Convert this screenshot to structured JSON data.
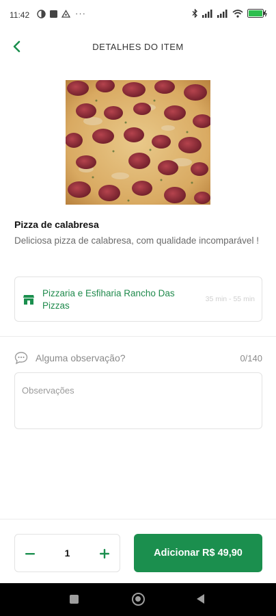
{
  "status_bar": {
    "time": "11:42",
    "more": "···",
    "icons": [
      "gmail-icon",
      "app-square-icon",
      "drive-icon",
      "bluetooth-icon",
      "signal-icon",
      "signal-icon",
      "wifi-icon",
      "battery-icon"
    ],
    "battery_color": "#2dbe4e"
  },
  "header": {
    "title": "DETALHES DO ITEM",
    "back_icon": "chevron-left-icon"
  },
  "item": {
    "name": "Pizza de calabresa",
    "description": "Deliciosa pizza de calabresa, com qualidade incomparável !",
    "image": "pizza-photo"
  },
  "store": {
    "name": "Pizzaria e Esfiharia Rancho Das Pizzas",
    "delivery_time": "35 min - 55 min",
    "icon": "store-icon"
  },
  "observation": {
    "label": "Alguma observação?",
    "counter": "0/140",
    "placeholder": "Observações",
    "icon": "chat-bubble-icon"
  },
  "footer": {
    "quantity": "1",
    "add_label": "Adicionar R$ 49,90"
  },
  "colors": {
    "accent": "#1b8f4e",
    "store_text": "#1f8a4c"
  },
  "nav_bar": {
    "icons": [
      "recent-apps-icon",
      "home-icon",
      "back-icon"
    ]
  }
}
